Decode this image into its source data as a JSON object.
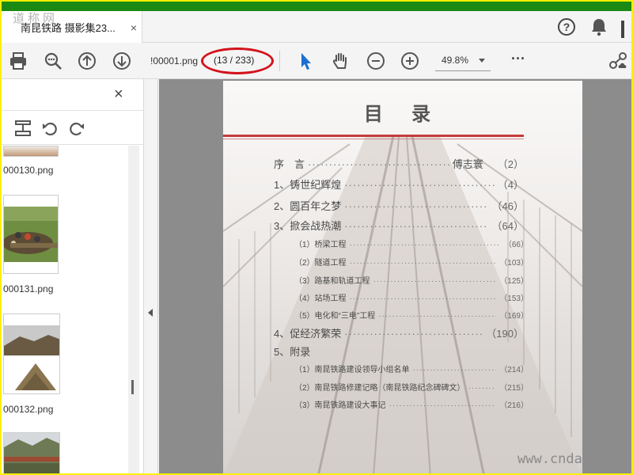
{
  "watermark": "道称网",
  "tab": {
    "title": "南昆铁路 摄影集23...",
    "close": "×"
  },
  "topbar": {
    "help": "?"
  },
  "toolbar": {
    "filename": "!00001.png",
    "page_indicator": "(13 / 233)",
    "zoom": "49.8%",
    "more": "···"
  },
  "sidebar": {
    "close": "×",
    "thumbnails": [
      {
        "label": "000130.png"
      },
      {
        "label": "000131.png"
      },
      {
        "label": "000132.png"
      }
    ]
  },
  "document": {
    "title": "目 录",
    "rows": [
      {
        "label": "序　言",
        "author": "傅志寰",
        "page": "（2）",
        "level": "main"
      },
      {
        "label": "1、铸世纪辉煌",
        "page": "（4）",
        "level": "main"
      },
      {
        "label": "2、圆百年之梦",
        "page": "（46）",
        "level": "main"
      },
      {
        "label": "3、掀会战热潮",
        "page": "（64）",
        "level": "main"
      },
      {
        "label": "（1）桥梁工程",
        "page": "（66）",
        "level": "sub"
      },
      {
        "label": "（2）隧道工程",
        "page": "（103）",
        "level": "sub"
      },
      {
        "label": "（3）路基和轨道工程",
        "page": "（125）",
        "level": "sub"
      },
      {
        "label": "（4）站场工程",
        "page": "（153）",
        "level": "sub"
      },
      {
        "label": "（5）电化和“三电”工程",
        "page": "（169）",
        "level": "sub"
      },
      {
        "label": "4、促经济繁荣",
        "page": "（190）",
        "level": "main"
      },
      {
        "label": "5、附录",
        "page": "",
        "level": "main"
      },
      {
        "label": "（1）南昆铁路建设领导小组名单",
        "page": "（214）",
        "level": "sub"
      },
      {
        "label": "（2）南昆铁路修建记略（南昆铁路纪念碑碑文）",
        "page": "（215）",
        "level": "sub"
      },
      {
        "label": "（3）南昆铁路建设大事记",
        "page": "（216）",
        "level": "sub"
      }
    ],
    "site_watermark": "www.cnda"
  },
  "colors": {
    "frame_border": "#ffef00",
    "title_bar": "#1a8a14",
    "annotation": "#d3131a",
    "accent": "#1a6fd1"
  },
  "icons": [
    "print-icon",
    "zoom-out-magnifier-icon",
    "page-up-icon",
    "page-down-icon",
    "select-cursor-icon",
    "hand-tool-icon",
    "zoom-minus-icon",
    "zoom-plus-icon",
    "share-cloud-icon",
    "help-icon",
    "bell-icon"
  ]
}
